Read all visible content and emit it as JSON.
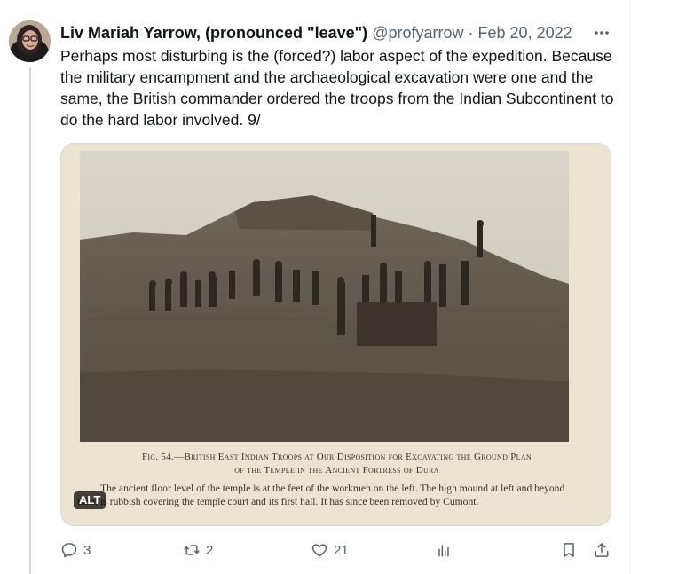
{
  "tweet": {
    "display_name": "Liv Mariah Yarrow, (pronounced \"leave\")",
    "handle": "@profyarrow",
    "separator": "·",
    "date": "Feb 20, 2022",
    "text": "Perhaps most disturbing is the (forced?) labor aspect of the expedition. Because the military encampment and the archaeological excavation were one and the same, the British commander ordered the troops from the Indian Subcontinent to do the hard labor involved. 9/"
  },
  "media": {
    "caption_title_line1": "Fig. 54.—British East Indian Troops at Our Disposition for Excavating the Ground Plan",
    "caption_title_line2": "of the Temple in the Ancient Fortress of Dura",
    "caption_body": "The ancient floor level of the temple is at the feet of the workmen on the left.   The high mound at left and beyond them is rubbish covering the temple court and its first hall.   It has since been removed by Cumont.",
    "alt_label": "ALT"
  },
  "actions": {
    "replies": "3",
    "reposts": "2",
    "likes": "21"
  },
  "icons": {
    "more": "more-horizontal-icon",
    "reply": "reply-bubble-icon",
    "repost": "repost-arrows-icon",
    "like": "heart-icon",
    "views": "bar-chart-icon",
    "bookmark": "bookmark-icon",
    "share": "share-upload-icon"
  },
  "colors": {
    "text": "#0f1419",
    "secondary": "#536471",
    "border": "#cfd9de"
  }
}
